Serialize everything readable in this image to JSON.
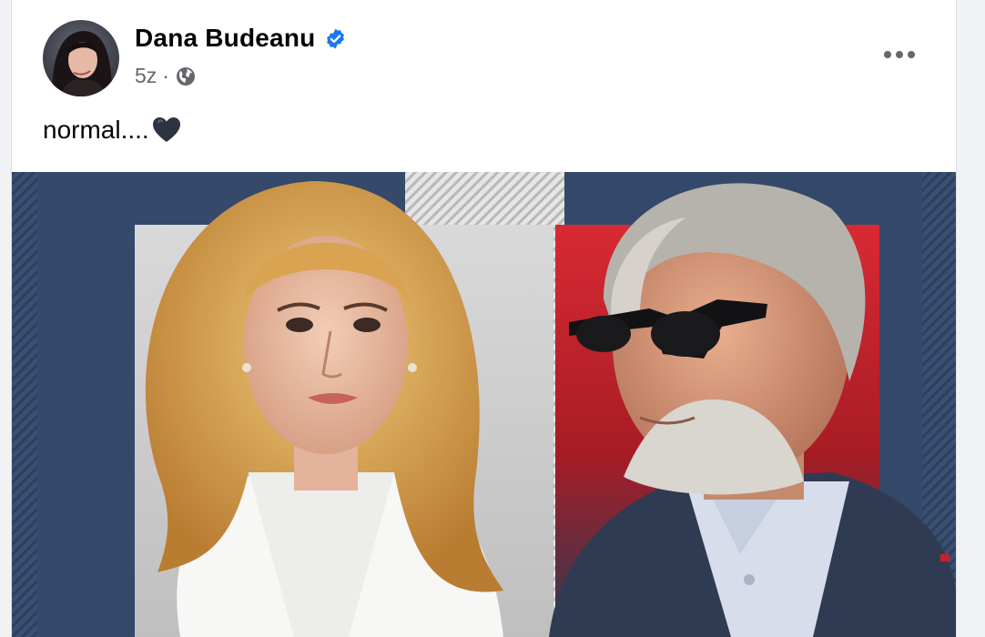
{
  "post": {
    "author": "Dana Budeanu",
    "verified": true,
    "timestamp": "5z",
    "separator": "·",
    "privacy_icon": "globe-icon",
    "text": "normal....",
    "emoji": "black-heart",
    "more_icon": "more-horizontal-icon"
  },
  "colors": {
    "verified_blue": "#1877f2",
    "meta_gray": "#65676b",
    "text": "#050505",
    "image_navy": "#34496a",
    "image_red": "#c8202a"
  }
}
